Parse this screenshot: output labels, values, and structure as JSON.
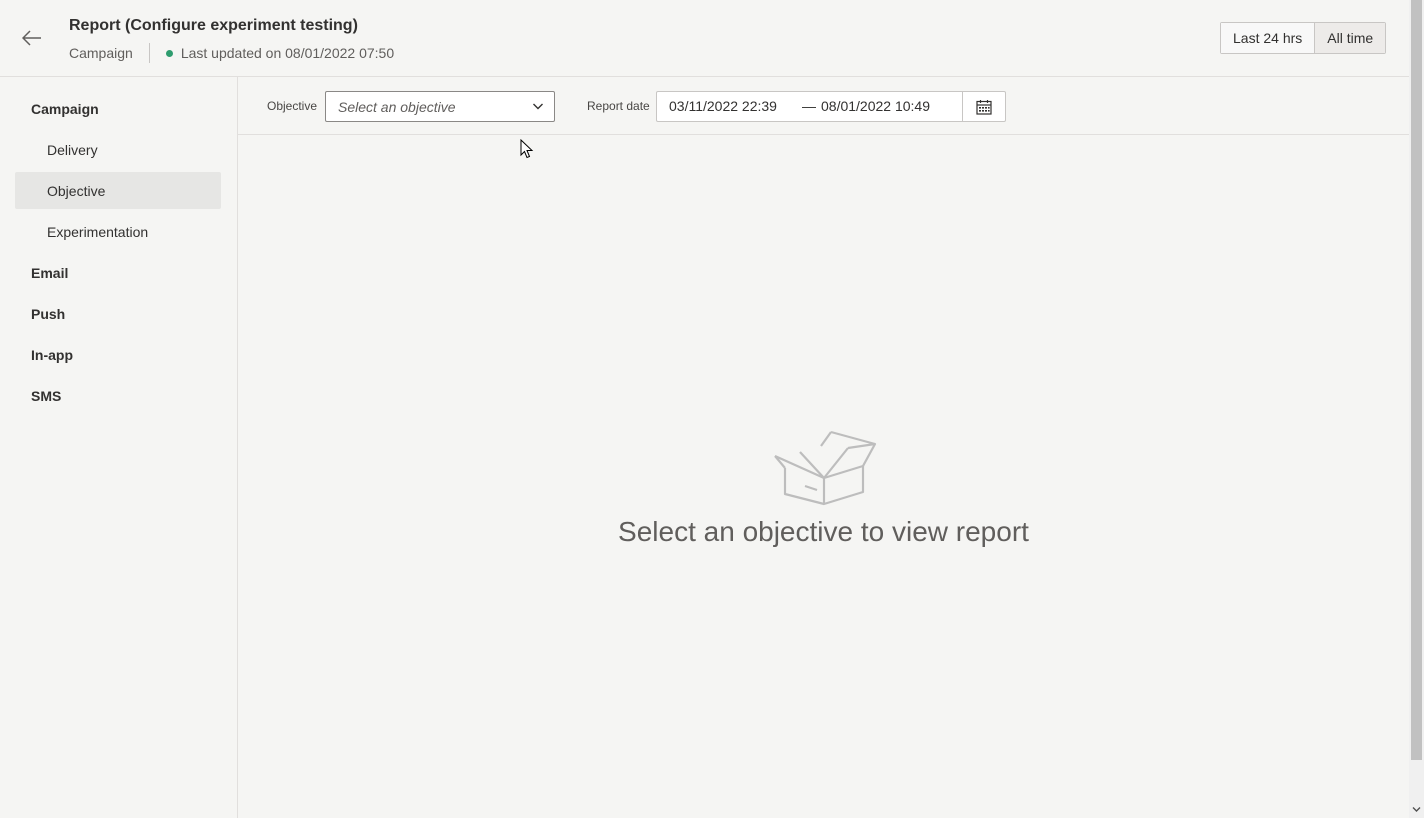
{
  "header": {
    "title": "Report (Configure experiment testing)",
    "breadcrumb": "Campaign",
    "last_updated": "Last updated on 08/01/2022 07:50",
    "status_color": "#2e9c6e",
    "range_options": [
      "Last 24 hrs",
      "All time"
    ],
    "active_range": "All time"
  },
  "sidebar": {
    "items": [
      {
        "label": "Campaign",
        "type": "group"
      },
      {
        "label": "Delivery",
        "type": "sub"
      },
      {
        "label": "Objective",
        "type": "sub",
        "selected": true
      },
      {
        "label": "Experimentation",
        "type": "sub"
      },
      {
        "label": "Email",
        "type": "group"
      },
      {
        "label": "Push",
        "type": "group"
      },
      {
        "label": "In-app",
        "type": "group"
      },
      {
        "label": "SMS",
        "type": "group"
      }
    ]
  },
  "filters": {
    "objective_label": "Objective",
    "objective_placeholder": "Select an objective",
    "report_date_label": "Report date",
    "date_start": "03/11/2022 22:39",
    "date_separator": "—",
    "date_end": "08/01/2022 10:49"
  },
  "empty_state": {
    "message": "Select an objective to view report",
    "icon": "open-box-icon"
  }
}
